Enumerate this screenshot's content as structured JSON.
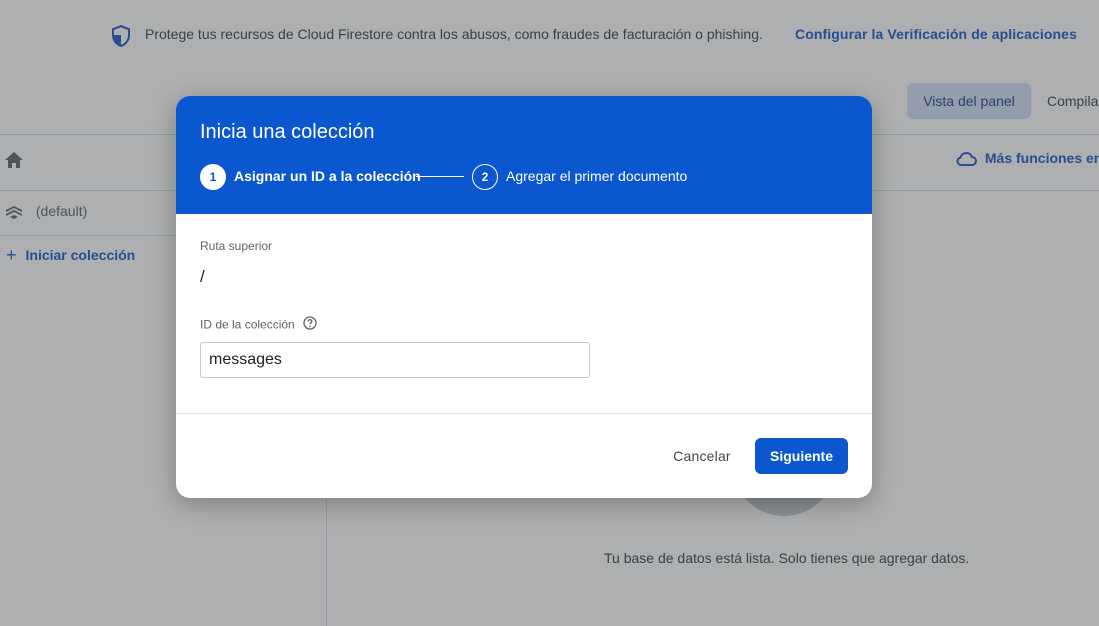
{
  "banner": {
    "shield_icon": "shield-check-icon",
    "text": "Protege tus recursos de Cloud Firestore contra los abusos, como fraudes de facturación o phishing.",
    "link": "Configurar la Verificación de aplicaciones"
  },
  "view_tabs": {
    "panel": "Vista del panel",
    "query": "Compila"
  },
  "toolbar": {
    "home_icon": "home-icon",
    "more_features": "Más funciones en",
    "cloud_icon": "cloud-icon"
  },
  "sidebar": {
    "database": "(default)",
    "database_icon": "firestore-icon",
    "start_collection_icon": "+",
    "start_collection": "Iniciar colección"
  },
  "main": {
    "empty_message": "Tu base de datos está lista. Solo tienes que agregar datos."
  },
  "dialog": {
    "title": "Inicia una colección",
    "steps": [
      {
        "number": "1",
        "label": "Asignar un ID a la colección",
        "active": true
      },
      {
        "number": "2",
        "label": "Agregar el primer documento",
        "active": false
      }
    ],
    "parent_path_label": "Ruta superior",
    "parent_path_value": "/",
    "collection_id_label": "ID de la colección",
    "help_icon": "help-circle-icon",
    "collection_id_value": "messages",
    "cancel_label": "Cancelar",
    "next_label": "Siguiente"
  },
  "colors": {
    "accent": "#0b57d0",
    "link": "#1a56c9",
    "tab_active_bg": "#d2e0fb"
  }
}
